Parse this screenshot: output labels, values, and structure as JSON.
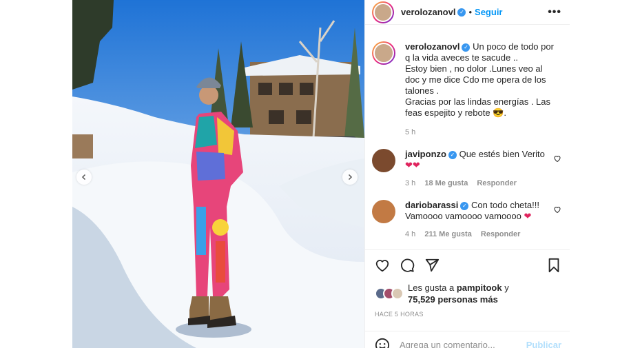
{
  "post": {
    "username": "verolozanovl",
    "follow_label": "Seguir",
    "caption_lines": [
      "Un poco de todo por q la vida aveces te sacude ..",
      "Estoy bien , no dolor .Lunes veo al doc y me dice Cdo me opera de los talones .",
      "Gracias por las lindas energías . Las feas espejito y rebote 😎."
    ],
    "caption_time": "5 h"
  },
  "comments": [
    {
      "username": "javiponzo",
      "text": "Que estés bien Verito",
      "hearts": "❤❤",
      "time": "3 h",
      "likes": "18 Me gusta",
      "reply_label": "Responder"
    },
    {
      "username": "dariobarassi",
      "text": "Con todo cheta!!! Vamoooo vamoooo vamoooo",
      "hearts": "❤",
      "time": "4 h",
      "likes": "211 Me gusta",
      "reply_label": "Responder"
    }
  ],
  "likes": {
    "prefix": "Les gusta a",
    "user": "pampitook",
    "conj": "y",
    "count": "75,529 personas más"
  },
  "posted_ago": "HACE 5 HORAS",
  "comment_box": {
    "placeholder": "Agrega un comentario...",
    "publish_label": "Publicar"
  },
  "icons": {
    "like": "heart-icon",
    "comment": "comment-icon",
    "share": "share-icon",
    "save": "bookmark-icon",
    "emoji": "emoji-icon",
    "prev": "chevron-left-icon",
    "next": "chevron-right-icon"
  },
  "colors": {
    "accent": "#0095f6",
    "verified": "#3897f0",
    "muted": "#8e8e8e"
  }
}
